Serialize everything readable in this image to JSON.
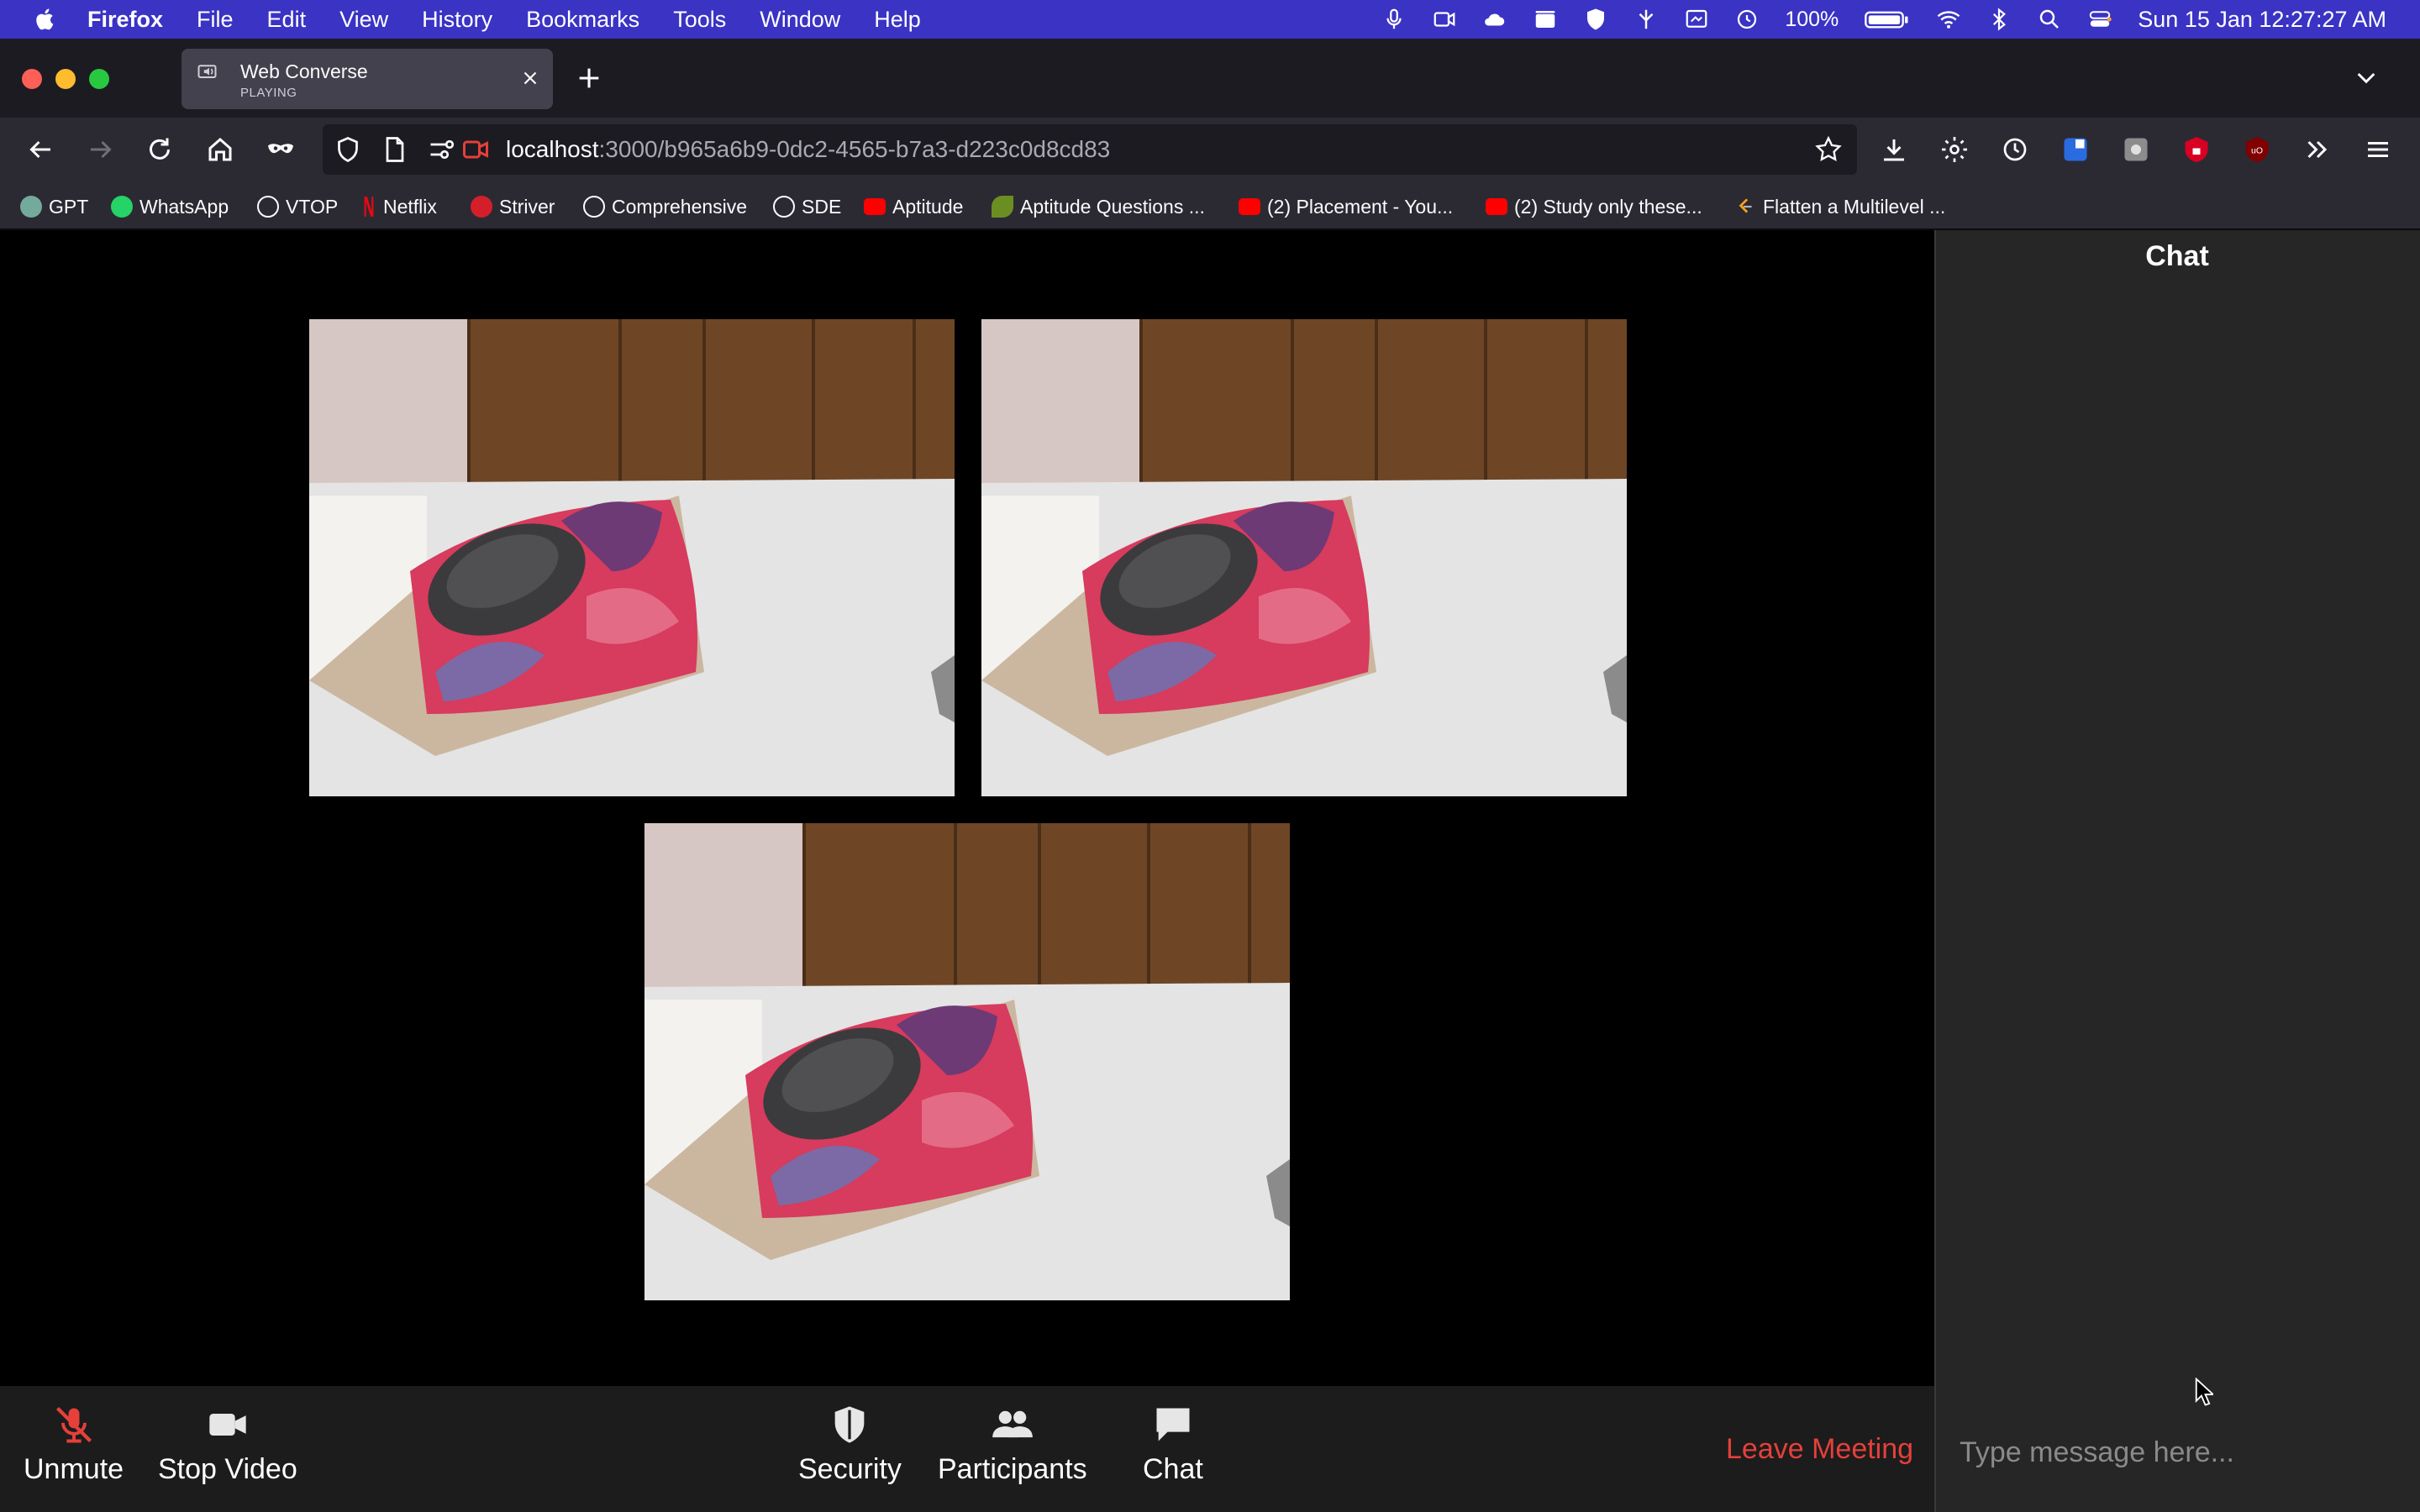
{
  "menubar": {
    "items": [
      "Firefox",
      "File",
      "Edit",
      "View",
      "History",
      "Bookmarks",
      "Tools",
      "Window",
      "Help"
    ],
    "battery": "100%",
    "clock": "Sun 15 Jan  12:27:27 AM"
  },
  "tab": {
    "title": "Web Converse",
    "subtitle": "PLAYING"
  },
  "url": {
    "host": "localhost",
    "path": ":3000/b965a6b9-0dc2-4565-b7a3-d223c0d8cd83"
  },
  "bookmarks": [
    "GPT",
    "WhatsApp",
    "VTOP",
    "Netflix",
    "Striver",
    "Comprehensive",
    "SDE",
    "Aptitude",
    "Aptitude Questions ...",
    "(2) Placement - You...",
    "(2) Study only these...",
    "Flatten a Multilevel ..."
  ],
  "controls": {
    "unmute": "Unmute",
    "stop_video": "Stop Video",
    "security": "Security",
    "participants": "Participants",
    "chat": "Chat",
    "leave": "Leave Meeting"
  },
  "chat": {
    "title": "Chat",
    "placeholder": "Type message here..."
  },
  "colors": {
    "menubar": "#3a33c4",
    "leave": "#e5403a",
    "muted_icon": "#e5403a"
  }
}
